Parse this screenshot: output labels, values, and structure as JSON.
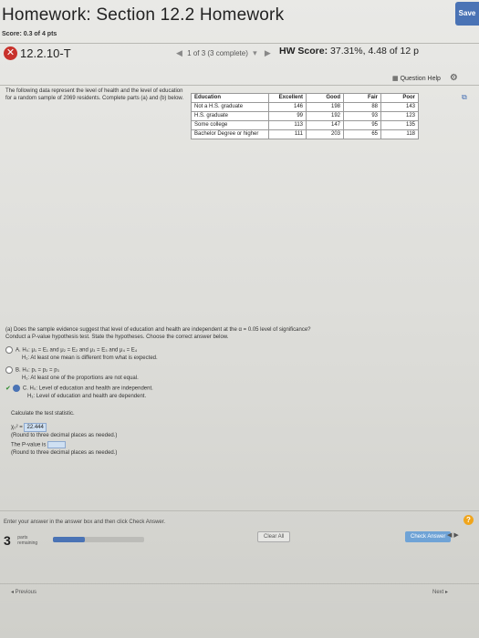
{
  "header": {
    "title": "Homework: Section 12.2 Homework",
    "save_label": "Save",
    "score": "Score: 0.3 of 4 pts",
    "question_id": "12.2.10-T",
    "question_nav": "1 of 3 (3 complete)",
    "hw_score_prefix": "HW Score: ",
    "hw_score_value": "37.31%, 4.48 of 12 p",
    "question_help": "Question Help"
  },
  "problem": {
    "intro": "The following data represent the level of health and the level of education for a random sample of 2069 residents. Complete parts (a) and (b) below.",
    "table": {
      "headers": [
        "Education",
        "Excellent",
        "Good",
        "Fair",
        "Poor"
      ],
      "rows": [
        [
          "Not a H.S. graduate",
          "146",
          "198",
          "88",
          "143"
        ],
        [
          "H.S. graduate",
          "99",
          "192",
          "93",
          "123"
        ],
        [
          "Some college",
          "113",
          "147",
          "95",
          "135"
        ],
        [
          "Bachelor Degree or higher",
          "111",
          "203",
          "65",
          "118"
        ]
      ]
    }
  },
  "part_a": {
    "question": "(a) Does the sample evidence suggest that level of education and health are independent at the α = 0.05 level of significance?",
    "instruction": "Conduct a P-value hypothesis test. State the hypotheses. Choose the correct answer below.",
    "options": [
      {
        "letter": "A.",
        "h0": "H₀: μ₁ = E₁ and μ₂ = E₂ and μ₃ = E₃ and μ₄ = E₄",
        "h1": "H₁: At least one mean is different from what is expected."
      },
      {
        "letter": "B.",
        "h0": "H₀: p₁ = p₂ = p₃",
        "h1": "H₁: At least one of the proportions are not equal."
      },
      {
        "letter": "C.",
        "h0": "H₀: Level of education and health are independent.",
        "h1": "H₁: Level of education and health are dependent."
      }
    ],
    "calc_label": "Calculate the test statistic.",
    "stat_prefix": "χ₀² = ",
    "stat_value": "22.444",
    "stat_round": "(Round to three decimal places as needed.)",
    "pvalue_label": "The P-value is",
    "pvalue_round": "(Round to three decimal places as needed.)"
  },
  "footer": {
    "enter_text": "Enter your answer in the answer box and then click Check Answer.",
    "parts_num": "3",
    "parts_label_1": "parts",
    "parts_label_2": "remaining",
    "progress": 0.35,
    "clear_all": "Clear All",
    "check_answer": "Check Answer",
    "previous": "◂ Previous",
    "next": "Next ▸",
    "help_symbol": "?"
  },
  "colors": {
    "accent": "#4a73b5",
    "incorrect": "#c8312b",
    "answer_box": "#cfe0f2",
    "help_circle": "#f0a51c"
  }
}
